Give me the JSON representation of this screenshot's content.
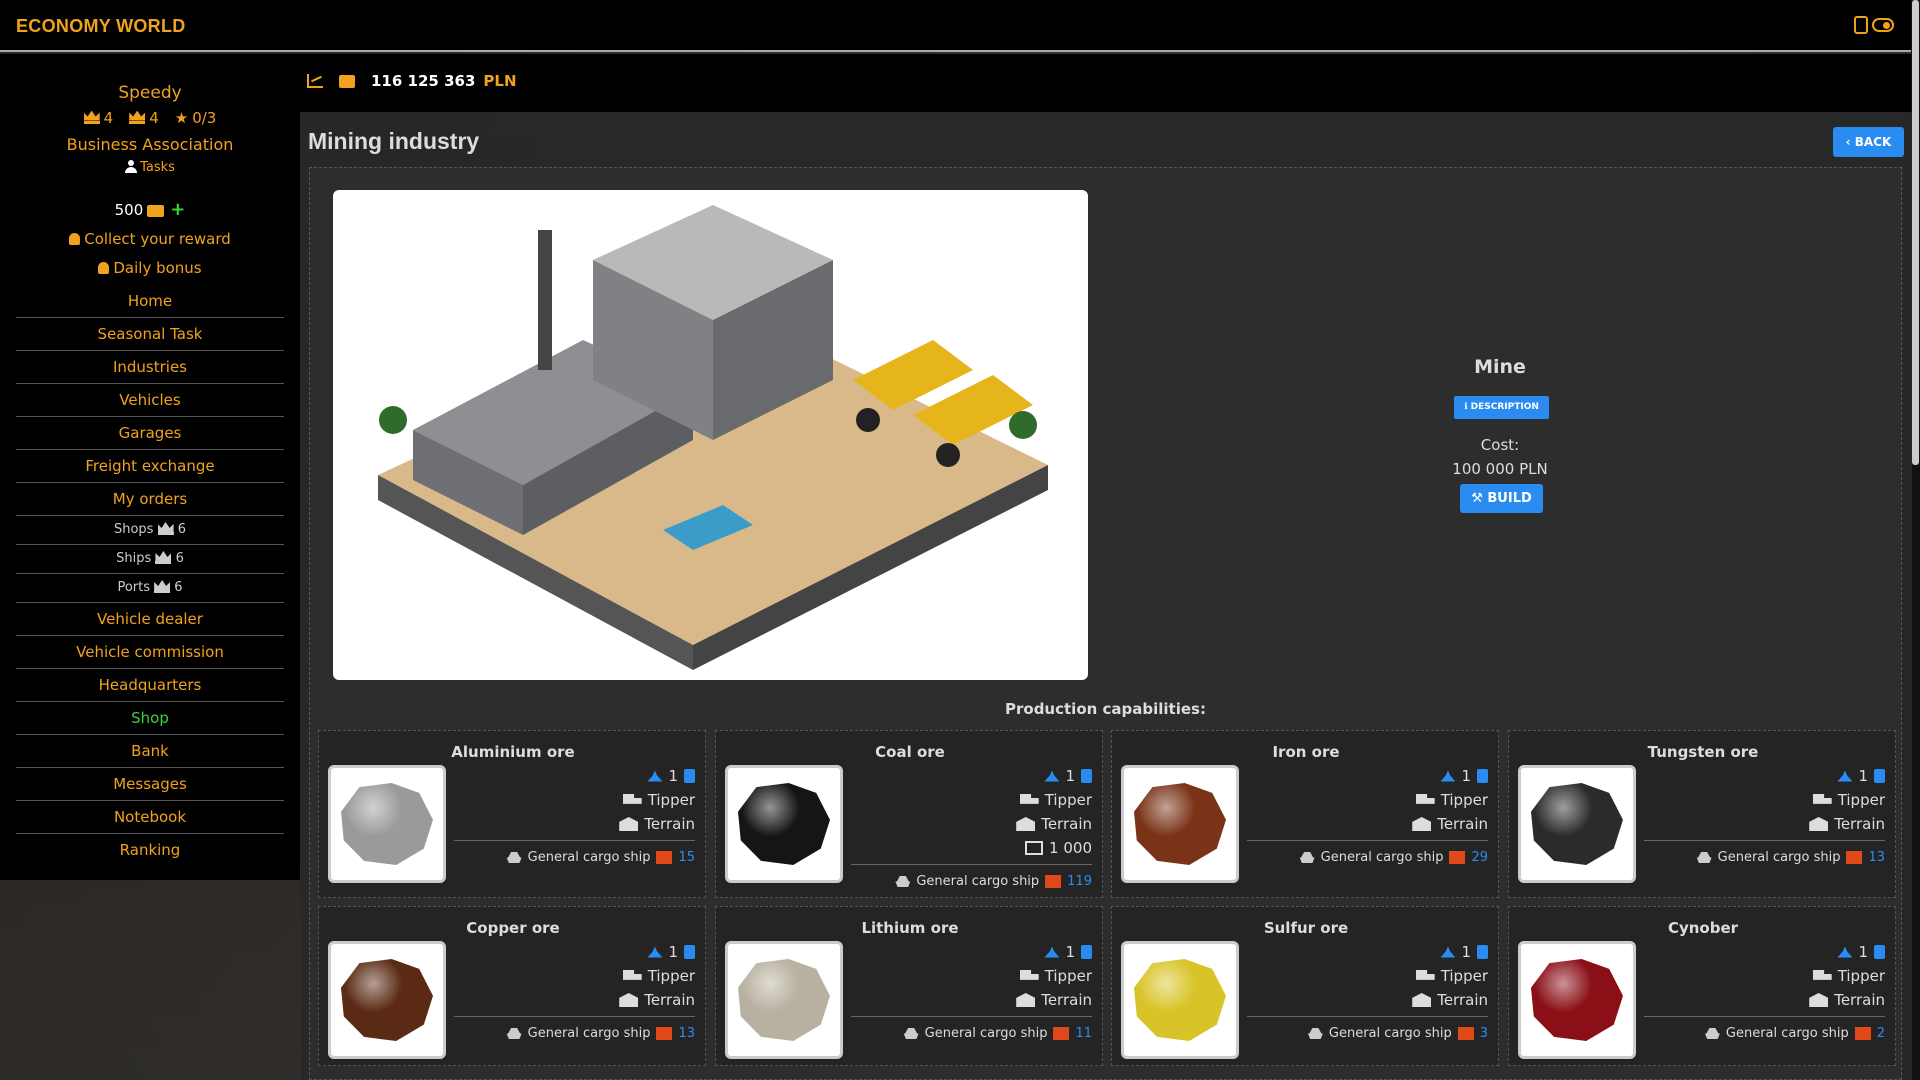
{
  "app": {
    "logo": "ECONOMY WORLD"
  },
  "header": {
    "balance": "116 125 363",
    "currency": "PLN"
  },
  "sidebar": {
    "username": "Speedy",
    "ranks": [
      {
        "icon": "crown-icon",
        "value": "4"
      },
      {
        "icon": "hat-icon",
        "value": "4"
      },
      {
        "icon": "star-icon",
        "value": "0/3"
      }
    ],
    "association": "Business Association",
    "tasks": "Tasks",
    "points": "500",
    "plus": "+",
    "collect_reward": "Collect your reward",
    "daily_bonus": "Daily bonus",
    "nav": [
      {
        "label": "Home"
      },
      {
        "label": "Seasonal Task"
      },
      {
        "label": "Industries"
      },
      {
        "label": "Vehicles"
      },
      {
        "label": "Garages"
      },
      {
        "label": "Freight exchange"
      },
      {
        "label": "My orders"
      },
      {
        "label": "Shops",
        "count": "6"
      },
      {
        "label": "Ships",
        "count": "6"
      },
      {
        "label": "Ports",
        "count": "6"
      },
      {
        "label": "Vehicle dealer"
      },
      {
        "label": "Vehicle commission"
      },
      {
        "label": "Headquarters"
      },
      {
        "label": "Shop"
      },
      {
        "label": "Bank"
      },
      {
        "label": "Messages"
      },
      {
        "label": "Notebook"
      },
      {
        "label": "Ranking"
      }
    ]
  },
  "page": {
    "title": "Mining industry",
    "back": "BACK",
    "facility": {
      "name": "Mine",
      "description_btn": "DESCRIPTION",
      "cost_label": "Cost:",
      "cost_value": "100 000  PLN",
      "build_btn": "BUILD"
    },
    "production_title": "Production capabilities:"
  },
  "resources": [
    {
      "name": "Aluminium ore",
      "workers": "1",
      "vehicle": "Tipper",
      "storage": "Terrain",
      "capacity": "",
      "ship": "General cargo ship",
      "ship_count": "15",
      "color": "#9a9a9a"
    },
    {
      "name": "Coal ore",
      "workers": "1",
      "vehicle": "Tipper",
      "storage": "Terrain",
      "capacity": "1 000",
      "ship": "General cargo ship",
      "ship_count": "119",
      "color": "#151515"
    },
    {
      "name": "Iron ore",
      "workers": "1",
      "vehicle": "Tipper",
      "storage": "Terrain",
      "capacity": "",
      "ship": "General cargo ship",
      "ship_count": "29",
      "color": "#7a3318"
    },
    {
      "name": "Tungsten ore",
      "workers": "1",
      "vehicle": "Tipper",
      "storage": "Terrain",
      "capacity": "",
      "ship": "General cargo ship",
      "ship_count": "13",
      "color": "#2b2b2b"
    },
    {
      "name": "Copper ore",
      "workers": "1",
      "vehicle": "Tipper",
      "storage": "Terrain",
      "capacity": "",
      "ship": "General cargo ship",
      "ship_count": "13",
      "color": "#5a2a14"
    },
    {
      "name": "Lithium ore",
      "workers": "1",
      "vehicle": "Tipper",
      "storage": "Terrain",
      "capacity": "",
      "ship": "General cargo ship",
      "ship_count": "11",
      "color": "#b8b0a0"
    },
    {
      "name": "Sulfur ore",
      "workers": "1",
      "vehicle": "Tipper",
      "storage": "Terrain",
      "capacity": "",
      "ship": "General cargo ship",
      "ship_count": "3",
      "color": "#d8c428"
    },
    {
      "name": "Cynober",
      "workers": "1",
      "vehicle": "Tipper",
      "storage": "Terrain",
      "capacity": "",
      "ship": "General cargo ship",
      "ship_count": "2",
      "color": "#8a0f16"
    }
  ],
  "colors": {
    "accent": "#f0a21c",
    "button": "#2a8cf0",
    "positive": "#3bd13b"
  }
}
